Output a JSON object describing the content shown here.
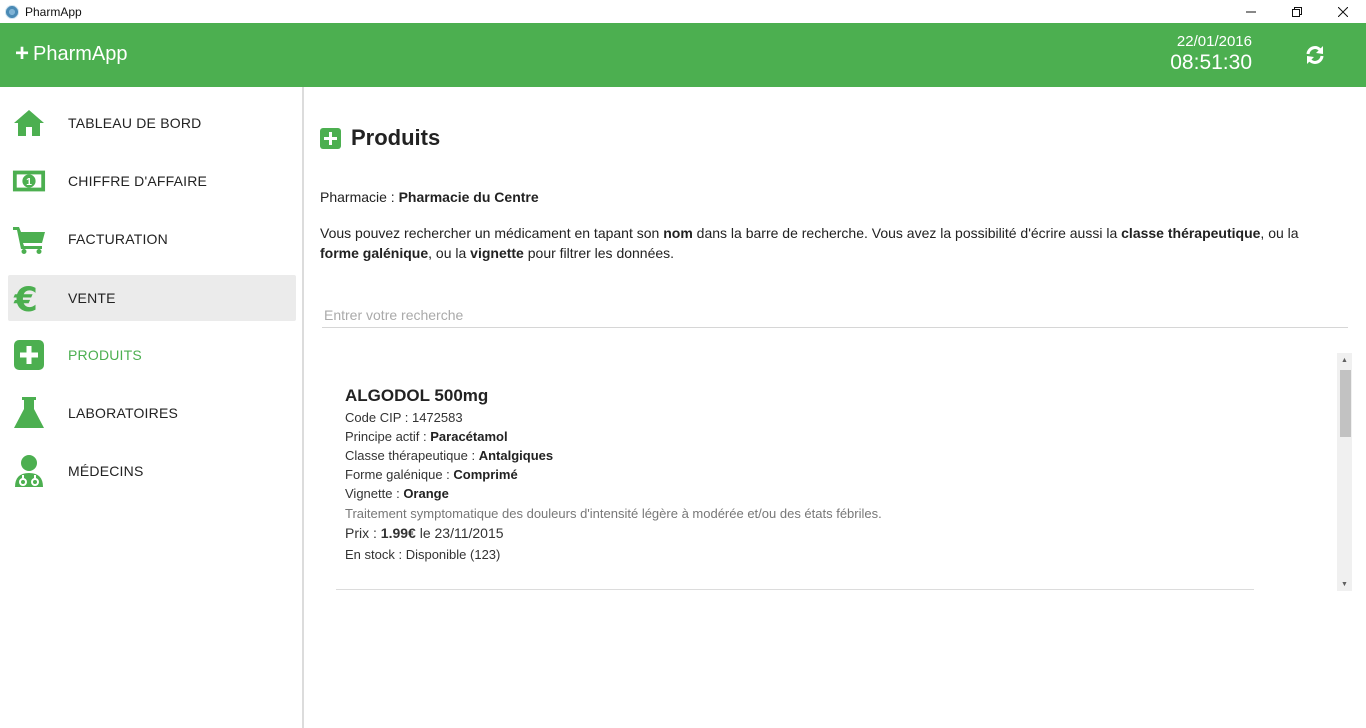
{
  "window": {
    "title": "PharmApp"
  },
  "header": {
    "brand": "PharmApp",
    "date": "22/01/2016",
    "time": "08:51:30"
  },
  "sidebar": {
    "items": [
      {
        "label": "TABLEAU DE BORD",
        "icon": "home-icon"
      },
      {
        "label": "CHIFFRE D'AFFAIRE",
        "icon": "money-icon"
      },
      {
        "label": "FACTURATION",
        "icon": "cart-icon"
      },
      {
        "label": "VENTE",
        "icon": "euro-icon",
        "state": "hover"
      },
      {
        "label": "PRODUITS",
        "icon": "plus-square-icon",
        "state": "current"
      },
      {
        "label": "LABORATOIRES",
        "icon": "flask-icon"
      },
      {
        "label": "MÉDECINS",
        "icon": "doctor-icon"
      }
    ]
  },
  "main": {
    "title": "Produits",
    "pharmacy_label": "Pharmacie : ",
    "pharmacy_name": "Pharmacie du Centre",
    "intro": {
      "t1": "Vous pouvez rechercher un médicament en tapant son ",
      "b1": "nom",
      "t2": " dans la barre de recherche. Vous avez la possibilité d'écrire aussi la ",
      "b2": "classe thérapeutique",
      "t3": ", ou la ",
      "b3": "forme galénique",
      "t4": ", ou la ",
      "b4": "vignette",
      "t5": " pour filtrer les données."
    },
    "search": {
      "placeholder": "Entrer votre recherche",
      "value": ""
    },
    "products": [
      {
        "name": "ALGODOL 500mg",
        "cip_label": "Code CIP : ",
        "cip": "1472583",
        "principe_label": "Principe actif : ",
        "principe": "Paracétamol",
        "classe_label": "Classe thérapeutique : ",
        "classe": "Antalgiques",
        "forme_label": "Forme galénique : ",
        "forme": "Comprimé",
        "vignette_label": "Vignette : ",
        "vignette": "Orange",
        "description": "Traitement symptomatique des douleurs d'intensité légère à modérée et/ou des états fébriles.",
        "prix_label": "Prix : ",
        "prix": "1.99€",
        "prix_date": " le 23/11/2015",
        "stock": "En stock : Disponible (123)"
      }
    ]
  },
  "colors": {
    "accent": "#4caf50",
    "hover_bg": "#ebebeb"
  }
}
